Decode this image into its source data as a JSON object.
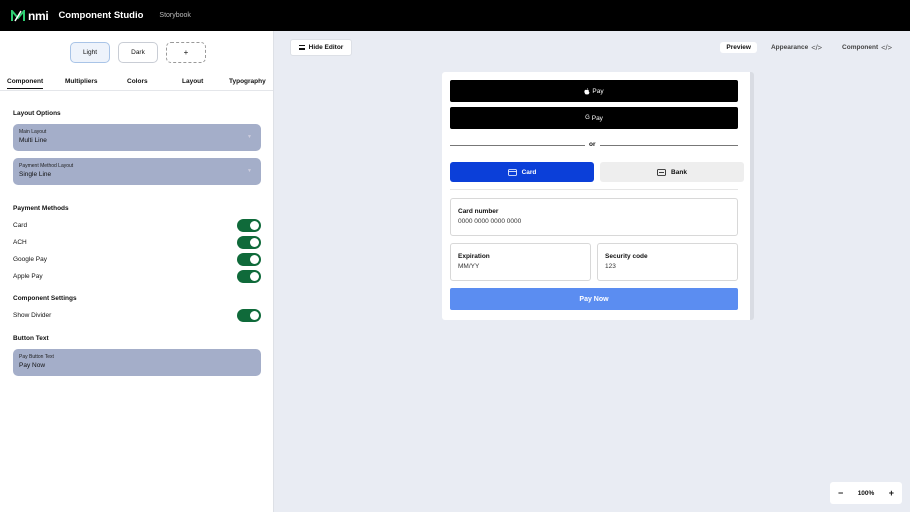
{
  "topbar": {
    "logo_text": "nmi",
    "title": "Component Studio",
    "subtitle": "Storybook"
  },
  "themes": {
    "light": "Light",
    "dark": "Dark",
    "add": "+"
  },
  "tabs": [
    "Component",
    "Multipliers",
    "Colors",
    "Layout",
    "Typography"
  ],
  "layout_options": {
    "title": "Layout Options",
    "main_layout": {
      "label": "Main Layout",
      "value": "Multi Line"
    },
    "payment_method_layout": {
      "label": "Payment Method Layout",
      "value": "Single Line"
    }
  },
  "payment_methods": {
    "title": "Payment Methods",
    "items": [
      {
        "label": "Card",
        "on": true
      },
      {
        "label": "ACH",
        "on": true
      },
      {
        "label": "Google Pay",
        "on": true
      },
      {
        "label": "Apple Pay",
        "on": true
      }
    ]
  },
  "component_settings": {
    "title": "Component Settings",
    "show_divider": {
      "label": "Show Divider",
      "on": true
    }
  },
  "button_text": {
    "title": "Button Text",
    "pay_button_text": {
      "label": "Pay Button Text",
      "value": "Pay Now"
    }
  },
  "toolbar": {
    "hide_editor": "Hide Editor",
    "preview": "Preview",
    "appearance": "Appearance",
    "component": "Component",
    "code_glyph": "</>"
  },
  "preview": {
    "apple_pay": "Pay",
    "google_pay": "Pay",
    "or": "or",
    "card": "Card",
    "bank": "Bank",
    "card_number": {
      "label": "Card number",
      "value": "0000 0000 0000 0000"
    },
    "expiration": {
      "label": "Expiration",
      "value": "MM/YY"
    },
    "security_code": {
      "label": "Security code",
      "value": "123"
    },
    "pay_now": "Pay Now"
  },
  "zoom": {
    "minus": "−",
    "level": "100%",
    "plus": "+"
  },
  "colors": {
    "accent": "#0b3fd9",
    "pay_now": "#5b8df1",
    "toggle_on": "#0f6a3a",
    "select_bg": "#a4aec9"
  }
}
